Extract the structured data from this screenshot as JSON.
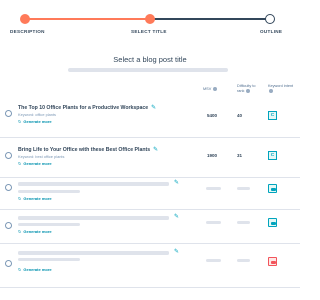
{
  "stepper": {
    "steps": [
      {
        "label": "DESCRIPTION",
        "state": "done"
      },
      {
        "label": "SELECT TITLE",
        "state": "active"
      },
      {
        "label": "OUTLINE",
        "state": "todo"
      }
    ]
  },
  "heading": "Select a blog post title",
  "columns": {
    "msv": "MSV",
    "difficulty": "Difficulty to rank",
    "keyword_intent": "Keyword intent"
  },
  "rows": [
    {
      "title": "The Top 10 Office Plants for a Productive Workspace",
      "keyword": "Keyword: office plants",
      "generate": "Generate more",
      "msv": "5400",
      "difficulty": "40",
      "intent": "C"
    },
    {
      "title": "Bring Life to Your Office with these Best Office Plants",
      "keyword": "Keyword: best office plants",
      "generate": "Generate more",
      "msv": "1900",
      "difficulty": "31",
      "intent": "C"
    }
  ],
  "placeholder_rows": [
    {
      "generate": "Generate more",
      "swatch_color": "#00a4bd"
    },
    {
      "generate": "Generate more",
      "swatch_color": "#00a4bd"
    },
    {
      "generate": "Generate more",
      "swatch_color": "#f2545b"
    }
  ],
  "colors": {
    "accent": "#ff7a59",
    "teal": "#00a4bd",
    "link": "#0091ae",
    "skeleton": "#dfe3eb"
  },
  "icons": {
    "edit": "pencil-icon",
    "refresh": "refresh-icon",
    "info": "info-icon"
  }
}
